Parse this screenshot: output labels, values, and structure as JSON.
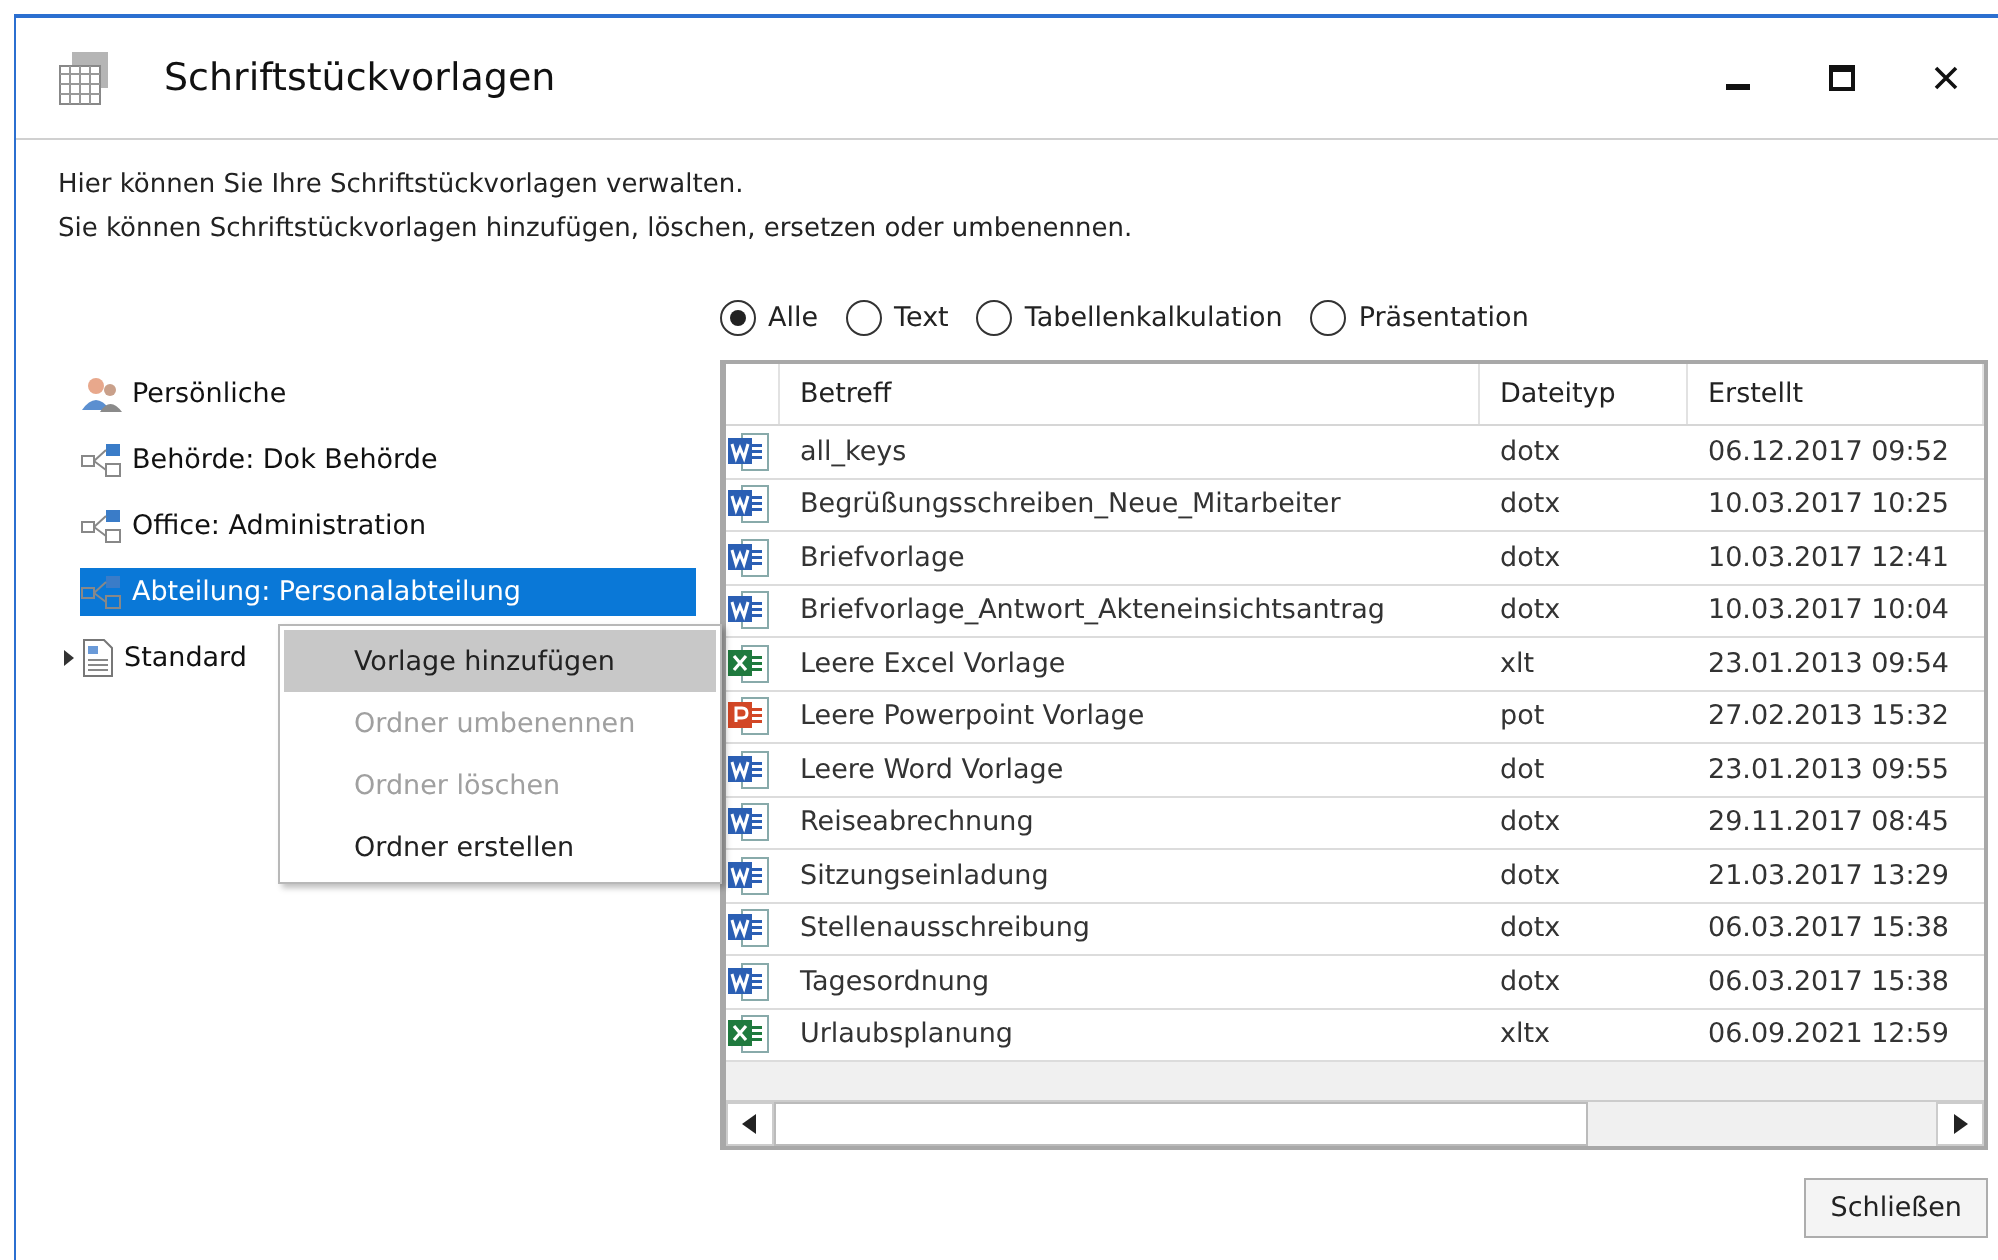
{
  "window": {
    "title": "Schriftstückvorlagen"
  },
  "description": [
    "Hier können Sie Ihre Schriftstückvorlagen verwalten.",
    "Sie können Schriftstückvorlagen hinzufügen, löschen, ersetzen oder umbenennen."
  ],
  "filters": [
    {
      "label": "Alle",
      "selected": true
    },
    {
      "label": "Text",
      "selected": false
    },
    {
      "label": "Tabellenkalkulation",
      "selected": false
    },
    {
      "label": "Präsentation",
      "selected": false
    }
  ],
  "tree": [
    {
      "label": "Persönliche",
      "kind": "person",
      "selected": false
    },
    {
      "label": "Behörde: Dok Behörde",
      "kind": "org",
      "selected": false
    },
    {
      "label": "Office: Administration",
      "kind": "org",
      "selected": false
    },
    {
      "label": "Abteilung: Personalabteilung",
      "kind": "org",
      "selected": true
    },
    {
      "label": "Standard",
      "kind": "doc",
      "selected": false,
      "expanded": false
    }
  ],
  "context_menu": [
    {
      "label": "Vorlage hinzufügen",
      "disabled": false,
      "selected": true
    },
    {
      "label": "Ordner umbenennen",
      "disabled": true,
      "selected": false
    },
    {
      "label": "Ordner löschen",
      "disabled": true,
      "selected": false
    },
    {
      "label": "Ordner erstellen",
      "disabled": false,
      "selected": false
    }
  ],
  "table": {
    "columns": [
      "Betreff",
      "Dateityp",
      "Erstellt"
    ],
    "rows": [
      {
        "kind": "word",
        "cells": [
          "all_keys",
          "dotx",
          "06.12.2017 09:52"
        ]
      },
      {
        "kind": "word",
        "cells": [
          "Begrüßungsschreiben_Neue_Mitarbeiter",
          "dotx",
          "10.03.2017 10:25"
        ]
      },
      {
        "kind": "word",
        "cells": [
          "Briefvorlage",
          "dotx",
          "10.03.2017 12:41"
        ]
      },
      {
        "kind": "word",
        "cells": [
          "Briefvorlage_Antwort_Akteneinsichtsantrag",
          "dotx",
          "10.03.2017 10:04"
        ]
      },
      {
        "kind": "excel",
        "cells": [
          "Leere Excel Vorlage",
          "xlt",
          "23.01.2013 09:54"
        ]
      },
      {
        "kind": "powerpoint",
        "cells": [
          "Leere Powerpoint Vorlage",
          "pot",
          "27.02.2013 15:32"
        ]
      },
      {
        "kind": "word",
        "cells": [
          "Leere Word Vorlage",
          "dot",
          "23.01.2013 09:55"
        ]
      },
      {
        "kind": "word",
        "cells": [
          "Reiseabrechnung",
          "dotx",
          "29.11.2017 08:45"
        ]
      },
      {
        "kind": "word",
        "cells": [
          "Sitzungseinladung",
          "dotx",
          "21.03.2017 13:29"
        ]
      },
      {
        "kind": "word",
        "cells": [
          "Stellenausschreibung",
          "dotx",
          "06.03.2017 15:38"
        ]
      },
      {
        "kind": "word",
        "cells": [
          "Tagesordnung",
          "dotx",
          "06.03.2017 15:38"
        ]
      },
      {
        "kind": "excel",
        "cells": [
          "Urlaubsplanung",
          "xltx",
          "06.09.2021 12:59"
        ]
      }
    ]
  },
  "buttons": [
    "Schließen"
  ]
}
